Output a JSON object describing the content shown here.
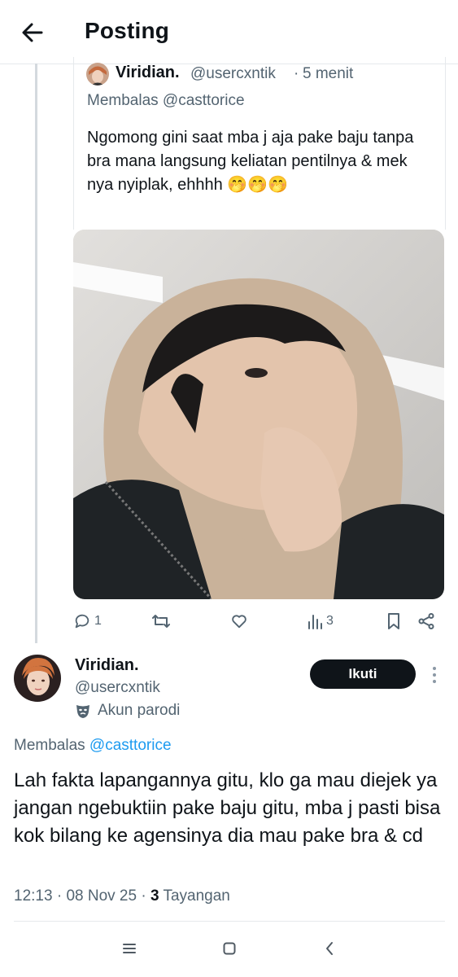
{
  "header": {
    "title": "Posting"
  },
  "quoted_post": {
    "name": "Viridian.",
    "handle": "@usercxntik",
    "separator": "·",
    "time": "5 menit",
    "replying_to": "Membalas @casttorice",
    "text": "Ngomong gini saat mba j aja pake baju tanpa bra mana langsung keliatan pentilnya & mek nya nyiplak, ehhhh 🤭🤭🤭",
    "actions": {
      "reply_count": "1",
      "repost_count": "",
      "like_count": "",
      "views_count": "3"
    }
  },
  "main_post": {
    "name": "Viridian.",
    "handle": "@usercxntik",
    "parody_label": "Akun parodi",
    "follow_label": "Ikuti",
    "replying_prefix": "Membalas ",
    "replying_handle": "@casttorice",
    "text": "Lah fakta lapangannya gitu, klo ga mau diejek ya jangan ngebuktiin pake baju gitu, mba j pasti bisa kok bilang ke agensinya dia mau pake bra & cd",
    "time": "12:13",
    "date": "08 Nov 25",
    "views_count": "3",
    "views_label": "Tayangan",
    "separator": "·"
  },
  "colors": {
    "text": "#0f1419",
    "muted": "#536471",
    "link": "#1d9bf0",
    "divider": "#e6e9ec",
    "thread_line": "#d4d9de",
    "follow_bg": "#0f1419"
  },
  "icons": {
    "back": "arrow-left-icon",
    "reply": "speech-bubble-icon",
    "repost": "repost-arrows-icon",
    "like": "heart-icon",
    "views": "bar-chart-icon",
    "bookmark": "bookmark-icon",
    "share": "share-icon",
    "parody": "theater-mask-icon",
    "more": "vertical-dots-icon",
    "nav_recents": "menu-lines-icon",
    "nav_home": "square-icon",
    "nav_back": "chevron-left-icon"
  }
}
